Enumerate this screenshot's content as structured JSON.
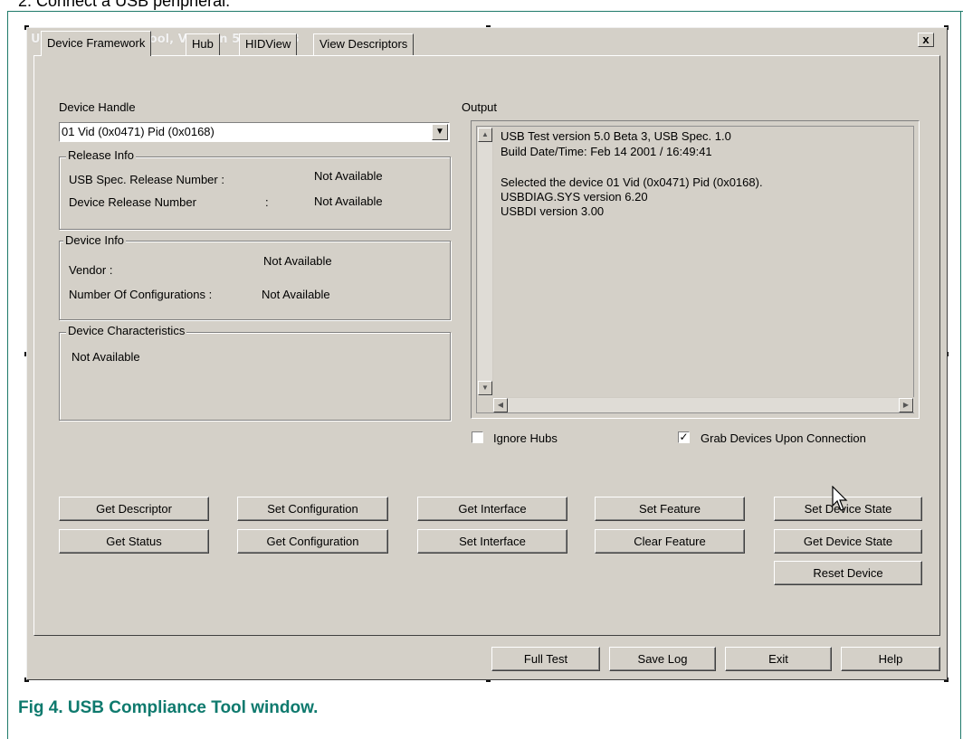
{
  "document": {
    "top_text": "2. Connect a USB peripheral.",
    "caption": "Fig 4.    USB Compliance Tool window."
  },
  "window": {
    "title": "USB Compliance Tool, Version 5.0 Beta 3",
    "close_label": "x"
  },
  "tabs": [
    {
      "label": "Device Framework",
      "active": true
    },
    {
      "label": "Hub",
      "active": false
    },
    {
      "label": "HIDView",
      "active": false
    },
    {
      "label": "View Descriptors",
      "active": false
    }
  ],
  "device_handle": {
    "label": "Device Handle",
    "selected": "01 Vid (0x0471) Pid (0x0168)"
  },
  "release_info": {
    "title": "Release Info",
    "usb_spec_label": "USB Spec. Release Number :",
    "usb_spec_value": "Not Available",
    "device_release_label": "Device Release Number",
    "device_release_sep": ":",
    "device_release_value": "Not Available"
  },
  "device_info": {
    "title": "Device Info",
    "vendor_label": "Vendor :",
    "vendor_value": "Not Available",
    "configs_label": "Number Of Configurations :",
    "configs_value": "Not Available"
  },
  "device_characteristics": {
    "title": "Device Characteristics",
    "value": "Not Available"
  },
  "output": {
    "label": "Output",
    "lines": [
      "USB Test version 5.0 Beta 3, USB Spec. 1.0",
      "Build Date/Time: Feb 14 2001 / 16:49:41",
      "",
      "Selected the device 01 Vid (0x0471) Pid (0x0168).",
      "USBDIAG.SYS version 6.20",
      "USBDI version 3.00"
    ]
  },
  "options": {
    "ignore_hubs": {
      "label": "Ignore Hubs",
      "checked": false
    },
    "grab_devices": {
      "label": "Grab Devices Upon Connection",
      "checked": true
    }
  },
  "buttons": {
    "get_descriptor": "Get Descriptor",
    "get_status": "Get Status",
    "set_configuration": "Set Configuration",
    "get_configuration": "Get Configuration",
    "get_interface": "Get Interface",
    "set_interface": "Set Interface",
    "set_feature": "Set Feature",
    "clear_feature": "Clear Feature",
    "set_device_state": "Set Device State",
    "get_device_state": "Get Device State",
    "reset_device": "Reset Device",
    "full_test": "Full Test",
    "save_log": "Save Log",
    "exit": "Exit",
    "help": "Help"
  },
  "icons": {
    "dropdown": "chevron-down-icon",
    "scroll_up": "arrow-up-icon",
    "scroll_down": "arrow-down-icon",
    "scroll_left": "arrow-left-icon",
    "scroll_right": "arrow-right-icon",
    "cursor": "mouse-pointer-icon",
    "check": "checkmark-icon"
  },
  "colors": {
    "window_face": "#d4d0c8",
    "caption_accent": "#0f7a6e"
  }
}
